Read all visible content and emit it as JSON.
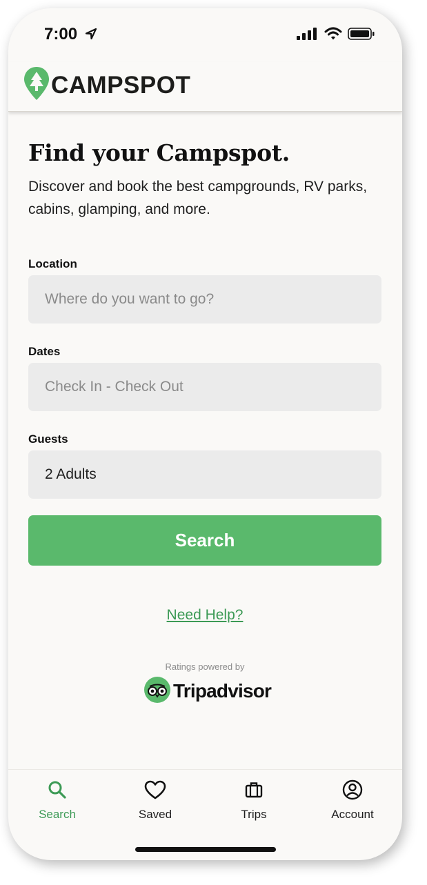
{
  "status_bar": {
    "time": "7:00"
  },
  "header": {
    "logo": "CAMPSPOT"
  },
  "main": {
    "title": "Find your Campspot.",
    "subtitle": "Discover and book the best campgrounds, RV parks, cabins, glamping, and more.",
    "location": {
      "label": "Location",
      "placeholder": "Where do you want to go?"
    },
    "dates": {
      "label": "Dates",
      "placeholder": "Check In - Check Out"
    },
    "guests": {
      "label": "Guests",
      "value": "2 Adults"
    },
    "search_button": "Search",
    "help_link": "Need Help?",
    "ratings_caption": "Ratings powered by",
    "tripadvisor": "Tripadvisor"
  },
  "tab_bar": {
    "items": [
      {
        "label": "Search",
        "icon": "search-icon",
        "active": true
      },
      {
        "label": "Saved",
        "icon": "heart-icon",
        "active": false
      },
      {
        "label": "Trips",
        "icon": "briefcase-icon",
        "active": false
      },
      {
        "label": "Account",
        "icon": "account-icon",
        "active": false
      }
    ]
  },
  "colors": {
    "brand_green": "#5ab96c",
    "link_green": "#3c9a55",
    "background": "#faf9f7",
    "field_bg": "#ebebeb"
  }
}
